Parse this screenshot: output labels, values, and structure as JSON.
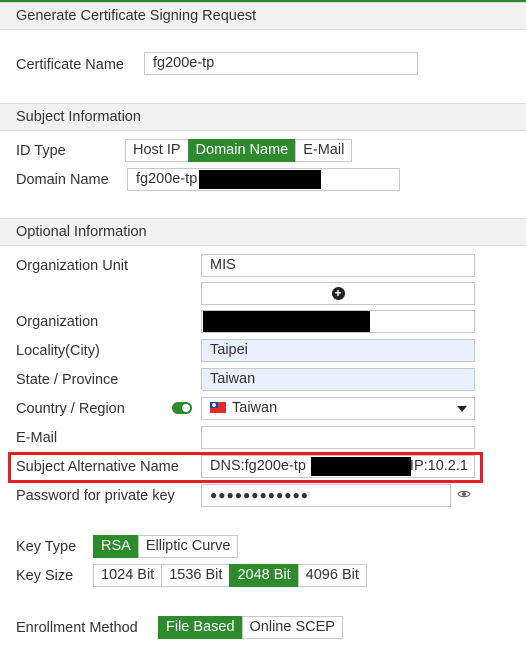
{
  "dialog": {
    "title": "Generate Certificate Signing Request",
    "certificate_name_label": "Certificate Name",
    "certificate_name_value": "fg200e-tp"
  },
  "subject": {
    "header": "Subject Information",
    "id_type_label": "ID Type",
    "id_type_options": [
      "Host IP",
      "Domain Name",
      "E-Mail"
    ],
    "id_type_selected": "Domain Name",
    "domain_name_label": "Domain Name",
    "domain_name_value": "fg200e-tp"
  },
  "optional": {
    "header": "Optional Information",
    "org_unit_label": "Organization Unit",
    "org_unit_value": "MIS",
    "organization_label": "Organization",
    "organization_value": "",
    "locality_label": "Locality(City)",
    "locality_value": "Taipei",
    "state_label": "State / Province",
    "state_value": "Taiwan",
    "country_label": "Country / Region",
    "country_value": "Taiwan",
    "country_toggle_on": true,
    "email_label": "E-Mail",
    "email_value": "",
    "san_label": "Subject Alternative Name",
    "san_value_prefix": "DNS:fg200e-tp",
    "san_value_suffix": "IP:10.2.1",
    "password_label": "Password for private key",
    "password_value": "●●●●●●●●●●●●"
  },
  "key": {
    "key_type_label": "Key Type",
    "key_type_options": [
      "RSA",
      "Elliptic Curve"
    ],
    "key_type_selected": "RSA",
    "key_size_label": "Key Size",
    "key_size_options": [
      "1024 Bit",
      "1536 Bit",
      "2048 Bit",
      "4096 Bit"
    ],
    "key_size_selected": "2048 Bit"
  },
  "enrollment": {
    "label": "Enrollment Method",
    "options": [
      "File Based",
      "Online SCEP"
    ],
    "selected": "File Based"
  },
  "colors": {
    "accent_green": "#2d8a2d",
    "highlight_red": "#e31f26",
    "autofill_blue": "#e8f0fe"
  }
}
